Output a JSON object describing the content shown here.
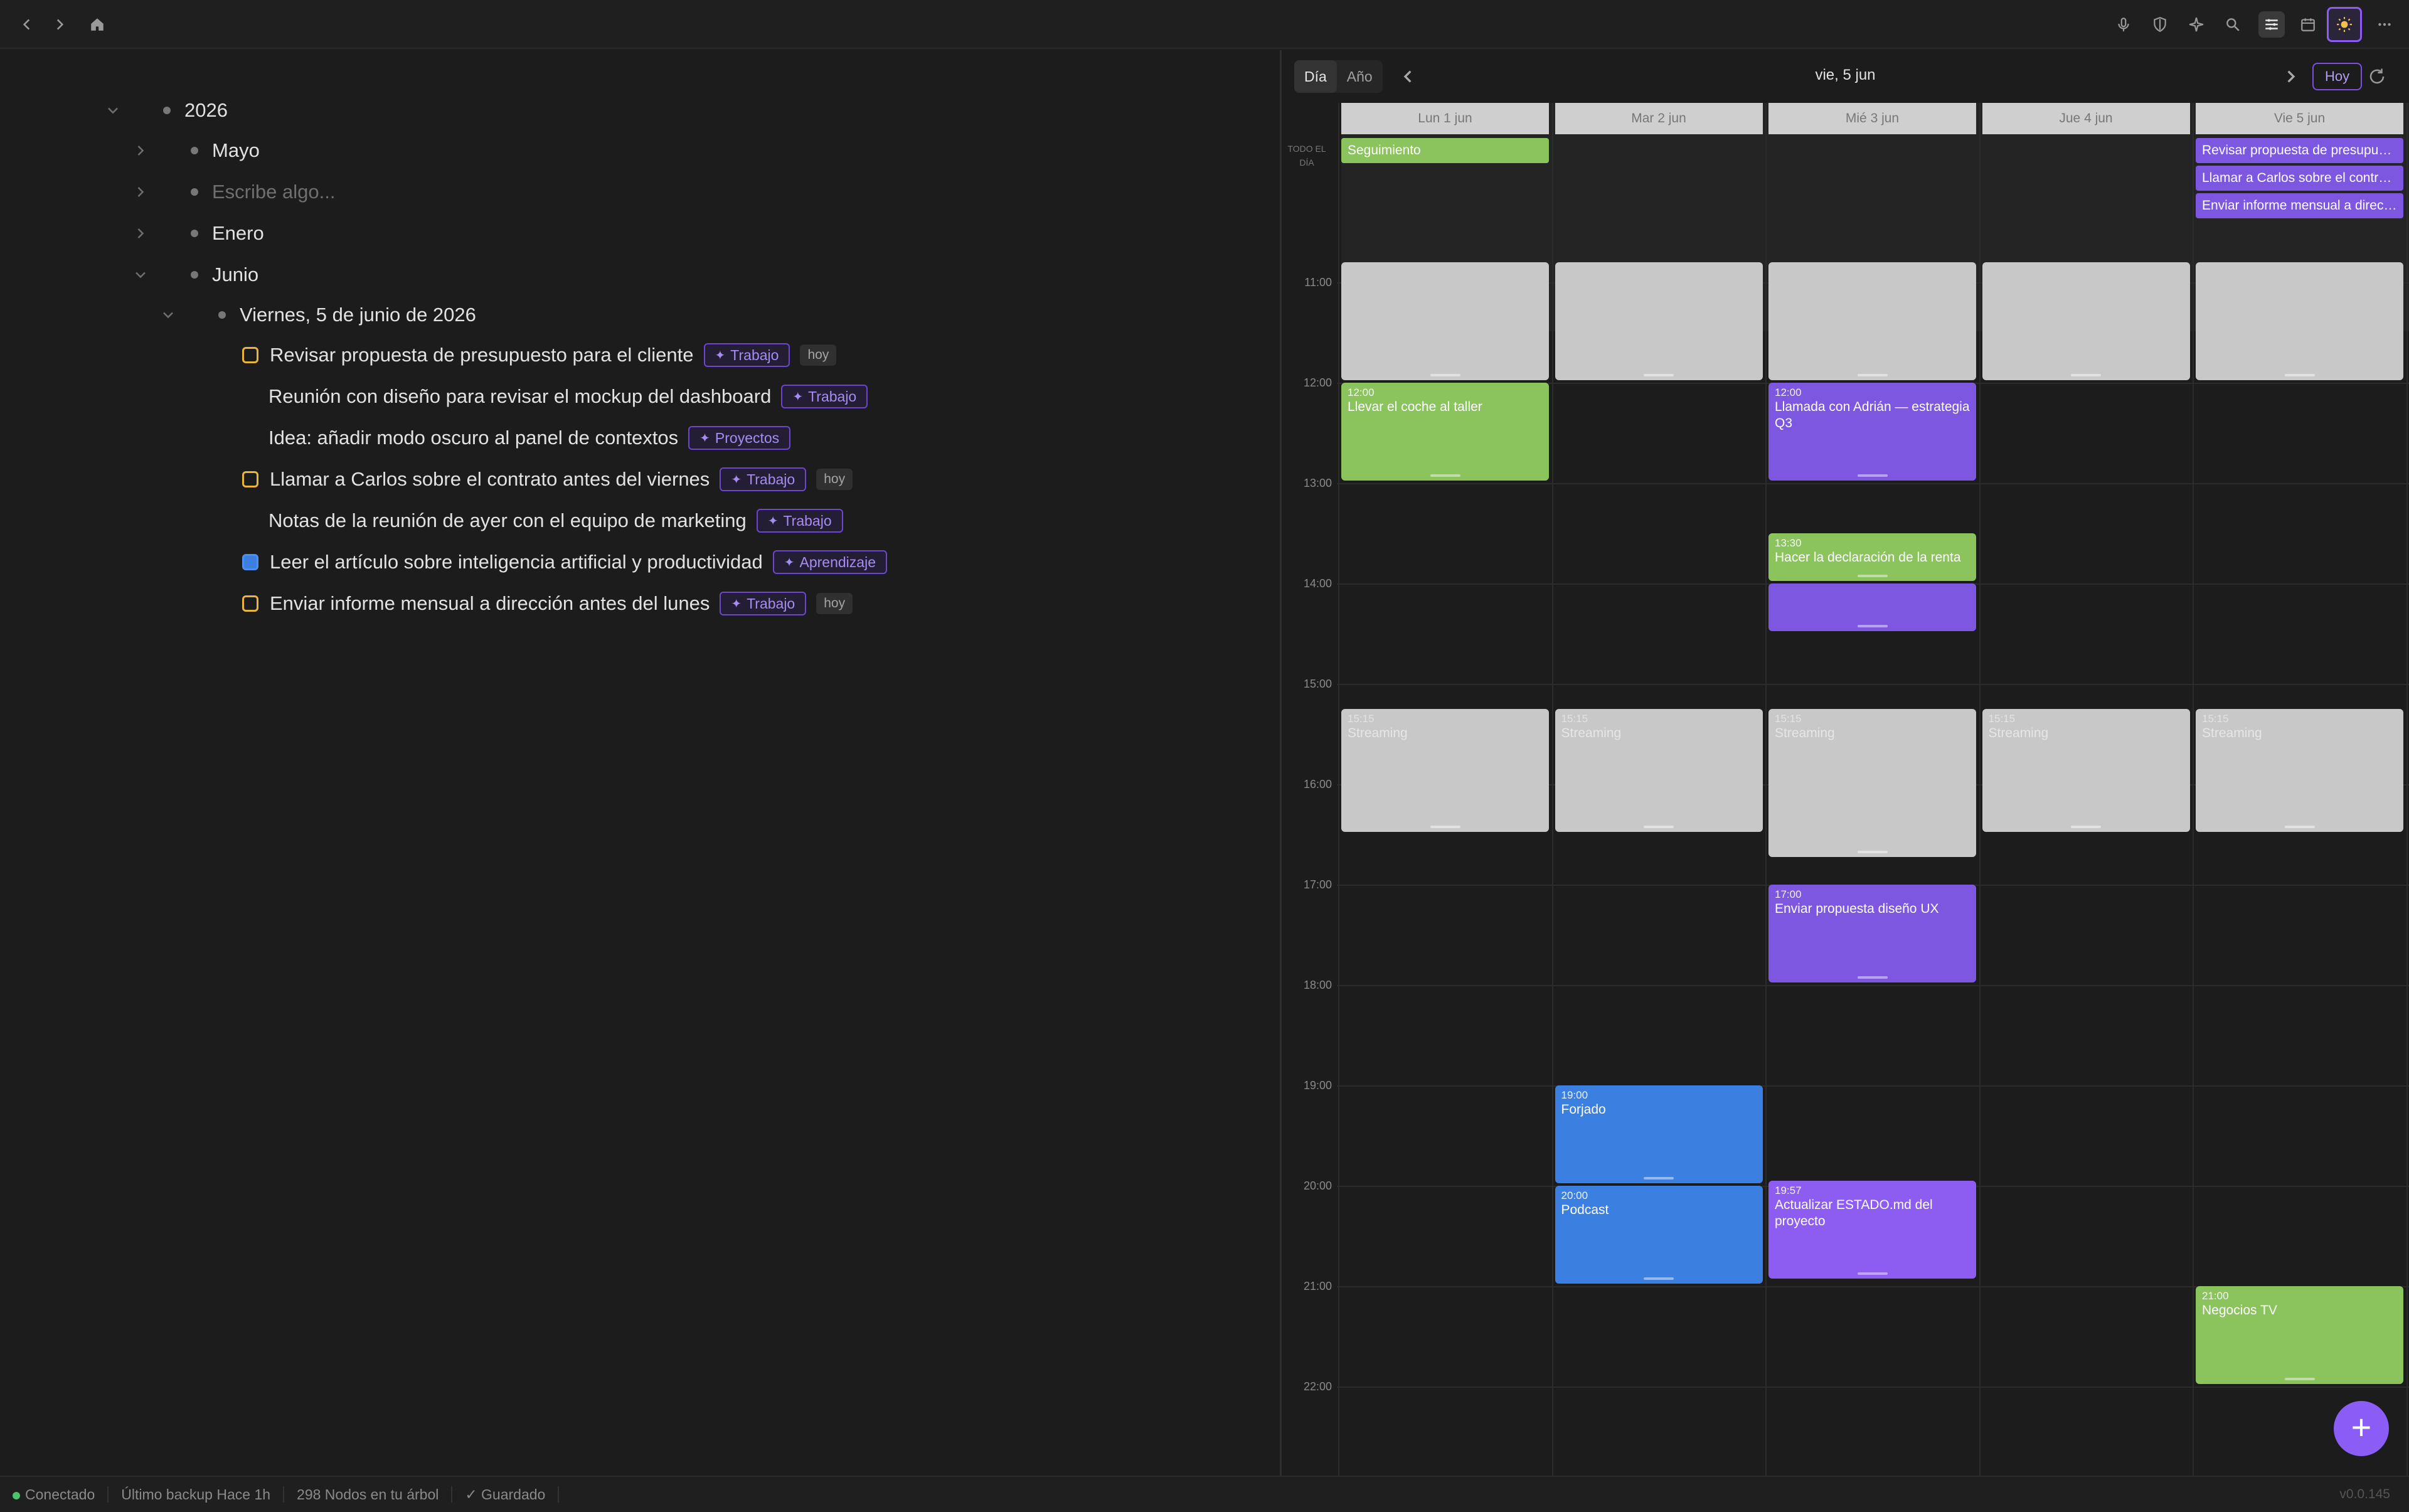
{
  "toolbar": {
    "back_icon": "chevron-left-icon",
    "forward_icon": "chevron-right-icon",
    "home_icon": "home-icon",
    "right_icons": [
      "mic-icon",
      "shield-icon",
      "sparkle-icon",
      "search-icon",
      "sliders-icon",
      "calendar-icon",
      "sun-icon",
      "more-icon"
    ],
    "accent": "#8b5cf6"
  },
  "outline": {
    "year": "2026",
    "months": [
      "Mayo",
      "Escribe algo...",
      "Enero",
      "Junio"
    ],
    "day_title": "Viernes, 5 de junio de 2026",
    "items": [
      {
        "text": "Revisar propuesta de presupuesto para el cliente",
        "tag": "Trabajo",
        "badge": "hoy",
        "check": "yellow"
      },
      {
        "text": "Reunión con diseño para revisar el mockup del dashboard",
        "tag": "Trabajo",
        "badge": "",
        "check": ""
      },
      {
        "text": "Idea: añadir modo oscuro al panel de contextos",
        "tag": "Proyectos",
        "badge": "",
        "check": ""
      },
      {
        "text": "Llamar a Carlos sobre el contrato antes del viernes",
        "tag": "Trabajo",
        "badge": "hoy",
        "check": "yellow"
      },
      {
        "text": "Notas de la reunión de ayer con el equipo de marketing",
        "tag": "Trabajo",
        "badge": "",
        "check": ""
      },
      {
        "text": "Leer el artículo sobre inteligencia artificial y productividad",
        "tag": "Aprendizaje",
        "badge": "",
        "check": "blue"
      },
      {
        "text": "Enviar informe mensual a dirección antes del lunes",
        "tag": "Trabajo",
        "badge": "hoy",
        "check": "yellow"
      }
    ]
  },
  "calendar": {
    "view_day": "Día",
    "view_year": "Año",
    "current_date": "vie, 5 jun",
    "today_button": "Hoy",
    "allday_label": "TODO EL DÍA",
    "days": [
      "Lun 1 jun",
      "Mar 2 jun",
      "Mié 3 jun",
      "Jue 4 jun",
      "Vie 5 jun"
    ],
    "hours": [
      "11:00",
      "12:00",
      "13:00",
      "14:00",
      "15:00",
      "16:00",
      "17:00",
      "18:00",
      "19:00",
      "20:00",
      "21:00",
      "22:00"
    ],
    "allday_events": [
      {
        "day": 0,
        "slot": 0,
        "title": "Seguimiento",
        "color": "green"
      },
      {
        "day": 4,
        "slot": 0,
        "title": "Revisar propuesta de presupuesto para el cliente",
        "color": "purple"
      },
      {
        "day": 4,
        "slot": 1,
        "title": "Llamar a Carlos sobre el contrato antes del viernes",
        "color": "purple"
      },
      {
        "day": 4,
        "slot": 2,
        "title": "Enviar informe mensual a dirección antes del lunes",
        "color": "purple"
      }
    ],
    "events": [
      {
        "day": 0,
        "start": 10.8,
        "end": 12.0,
        "time": "",
        "title": "",
        "color": "grey"
      },
      {
        "day": 1,
        "start": 10.8,
        "end": 12.0,
        "time": "",
        "title": "",
        "color": "grey"
      },
      {
        "day": 2,
        "start": 10.8,
        "end": 12.0,
        "time": "",
        "title": "",
        "color": "grey"
      },
      {
        "day": 3,
        "start": 10.8,
        "end": 12.0,
        "time": "",
        "title": "",
        "color": "grey"
      },
      {
        "day": 4,
        "start": 10.8,
        "end": 12.0,
        "time": "",
        "title": "",
        "color": "grey"
      },
      {
        "day": 0,
        "start": 12.0,
        "end": 13.0,
        "time": "12:00",
        "title": "Llevar el coche al taller",
        "color": "green"
      },
      {
        "day": 2,
        "start": 12.0,
        "end": 13.0,
        "time": "12:00",
        "title": "Llamada con Adrián — estrategia Q3",
        "color": "purple"
      },
      {
        "day": 2,
        "start": 13.5,
        "end": 14.0,
        "time": "13:30",
        "title": "Hacer la declaración de la renta",
        "color": "green"
      },
      {
        "day": 2,
        "start": 14.0,
        "end": 14.5,
        "time": "",
        "title": "",
        "color": "purple"
      },
      {
        "day": 0,
        "start": 15.25,
        "end": 16.5,
        "time": "15:15",
        "title": "Streaming",
        "color": "grey"
      },
      {
        "day": 1,
        "start": 15.25,
        "end": 16.5,
        "time": "15:15",
        "title": "Streaming",
        "color": "grey"
      },
      {
        "day": 2,
        "start": 15.25,
        "end": 16.75,
        "time": "15:15",
        "title": "Streaming",
        "color": "grey"
      },
      {
        "day": 3,
        "start": 15.25,
        "end": 16.5,
        "time": "15:15",
        "title": "Streaming",
        "color": "grey"
      },
      {
        "day": 4,
        "start": 15.25,
        "end": 16.5,
        "time": "15:15",
        "title": "Streaming",
        "color": "grey"
      },
      {
        "day": 2,
        "start": 17.0,
        "end": 18.0,
        "time": "17:00",
        "title": "Enviar propuesta diseño UX",
        "color": "purple"
      },
      {
        "day": 1,
        "start": 19.0,
        "end": 20.0,
        "time": "19:00",
        "title": "Forjado",
        "color": "blue"
      },
      {
        "day": 1,
        "start": 20.0,
        "end": 21.0,
        "time": "20:00",
        "title": "Podcast",
        "color": "blue"
      },
      {
        "day": 2,
        "start": 19.95,
        "end": 20.95,
        "time": "19:57",
        "title": "Actualizar ESTADO.md del proyecto",
        "color": "purple2"
      },
      {
        "day": 4,
        "start": 21.0,
        "end": 22.0,
        "time": "21:00",
        "title": "Negocios TV",
        "color": "green"
      }
    ]
  },
  "status": {
    "connected": "Conectado",
    "backup": "Último backup Hace 1h",
    "nodes": "298 Nodos en tu árbol",
    "saved": "✓ Guardado",
    "version": "v0.0.145"
  }
}
